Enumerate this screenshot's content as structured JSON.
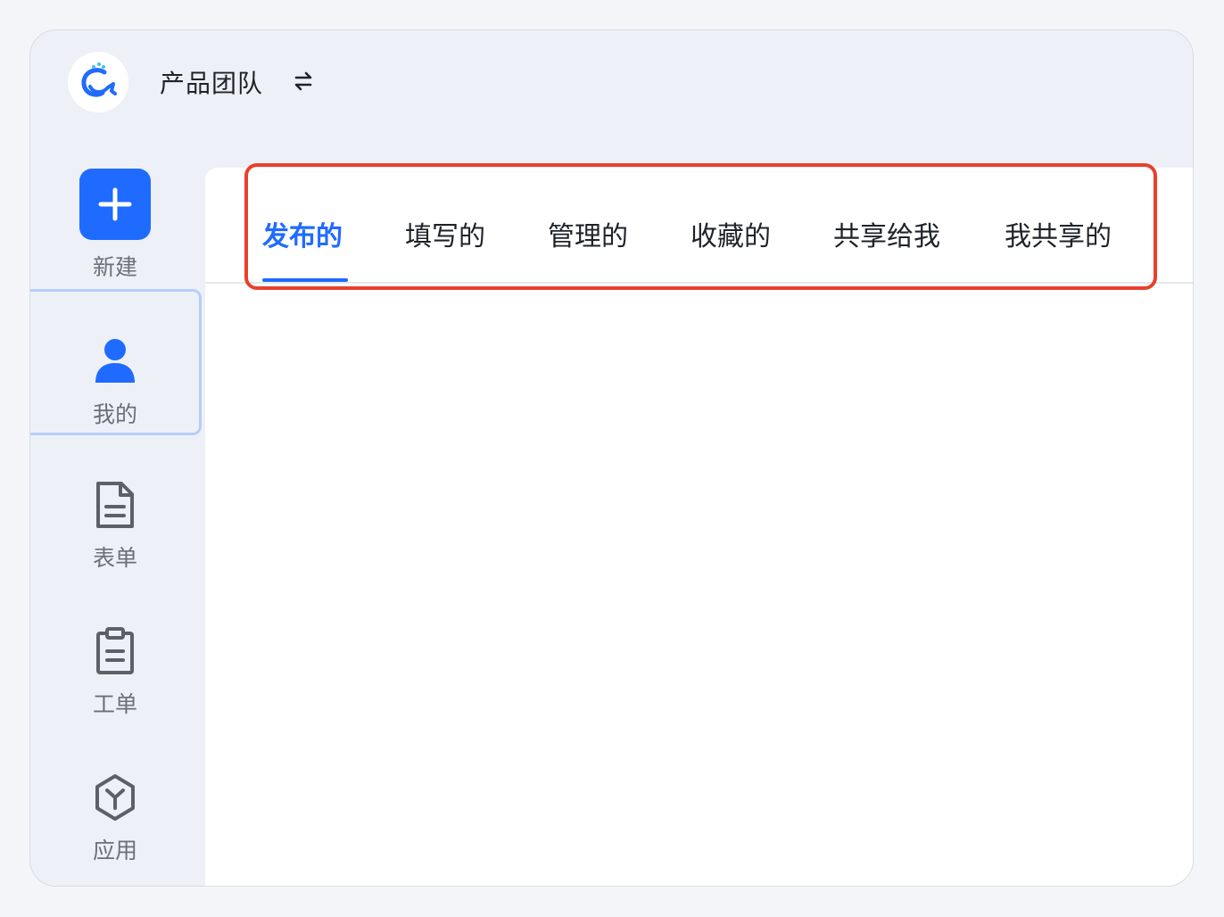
{
  "header": {
    "team_name": "产品团队"
  },
  "sidebar": {
    "new_label": "新建",
    "items": [
      {
        "label": "我的",
        "icon": "user-icon",
        "active": true
      },
      {
        "label": "表单",
        "icon": "form-document-icon",
        "active": false
      },
      {
        "label": "工单",
        "icon": "clipboard-icon",
        "active": false
      },
      {
        "label": "应用",
        "icon": "app-hexagon-icon",
        "active": false
      }
    ]
  },
  "main": {
    "tabs": [
      {
        "label": "发布的",
        "active": true
      },
      {
        "label": "填写的",
        "active": false
      },
      {
        "label": "管理的",
        "active": false
      },
      {
        "label": "收藏的",
        "active": false
      },
      {
        "label": "共享给我",
        "active": false
      },
      {
        "label": "我共享的",
        "active": false
      }
    ]
  },
  "colors": {
    "accent": "#1f6bff",
    "highlight": "#e8402c",
    "sidebar_bg": "#eef0f7",
    "text": "#1f2329",
    "muted_text": "#6b6f78"
  }
}
